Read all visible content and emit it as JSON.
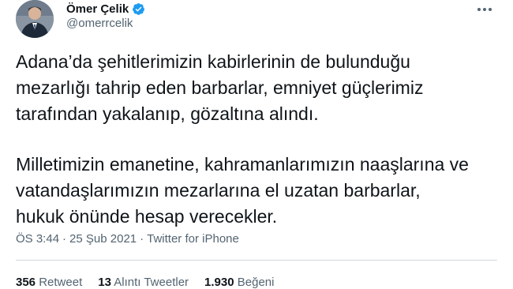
{
  "tweet": {
    "author_name": "Ömer Çelik",
    "author_handle": "@omerrcelik",
    "paragraph1": "Adana’da şehitlerimizin kabirlerinin de bulunduğu\nmezarlığı tahrip eden barbarlar, emniyet güçlerimiz\ntarafından yakalanıp, gözaltına alındı.",
    "paragraph2": "Milletimizin emanetine, kahramanlarımızın naaşlarına ve\nvatandaşlarımızın mezarlarına el uzatan barbarlar,\nhukuk önünde hesap verecekler.",
    "time": "ÖS 3:44",
    "date": "25 Şub 2021",
    "separator": "·",
    "source": "Twitter for iPhone"
  },
  "stats": {
    "retweets_count": "356",
    "retweets_label": "Retweet",
    "quotes_count": "13",
    "quotes_label": "Alıntı Tweetler",
    "likes_count": "1.930",
    "likes_label": "Beğeni"
  },
  "colors": {
    "verified": "#1d9bf0",
    "secondary_text": "#536471",
    "primary_text": "#0f1419"
  },
  "icons": [
    "verified-badge-icon",
    "more-options-icon"
  ]
}
